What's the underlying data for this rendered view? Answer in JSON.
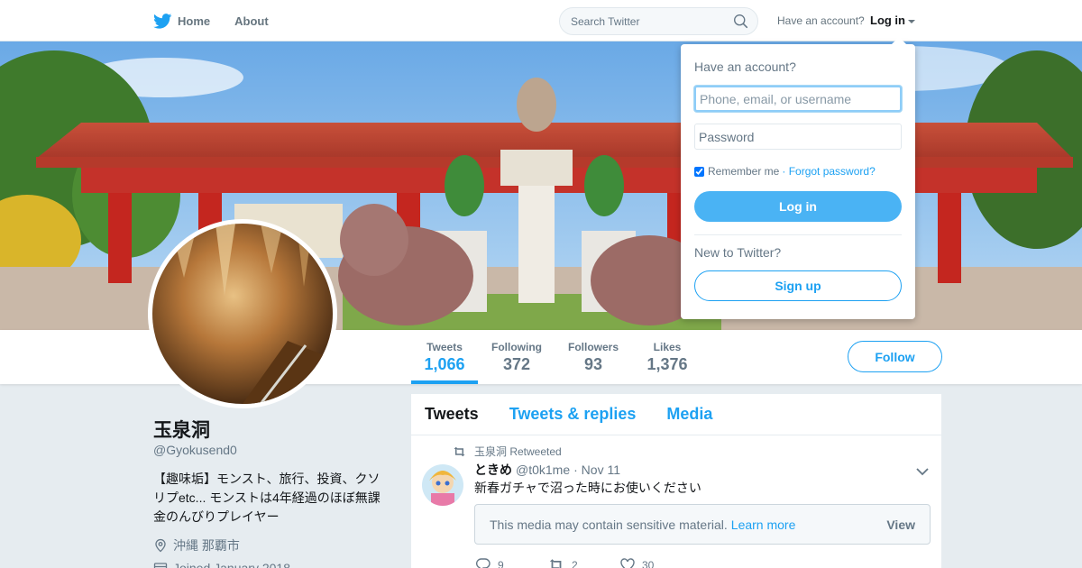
{
  "nav": {
    "home_label": "Home",
    "about_label": "About",
    "search_placeholder": "Search Twitter",
    "have_account": "Have an account?",
    "login_label": "Log in"
  },
  "profile": {
    "name": "玉泉洞",
    "handle": "@Gyokusend0",
    "bio": "【趣味垢】モンスト、旅行、投資、クソリプetc... モンストは4年経過のほぼ無課金のんびりプレイヤー",
    "location": "沖縄 那覇市",
    "joined": "Joined January 2018"
  },
  "stats": [
    {
      "label": "Tweets",
      "value": "1,066",
      "active": true
    },
    {
      "label": "Following",
      "value": "372",
      "active": false
    },
    {
      "label": "Followers",
      "value": "93",
      "active": false
    },
    {
      "label": "Likes",
      "value": "1,376",
      "active": false
    }
  ],
  "follow_label": "Follow",
  "timeline": {
    "tabs": [
      "Tweets",
      "Tweets & replies",
      "Media"
    ],
    "retweeted_by": "玉泉洞 Retweeted",
    "tweet": {
      "author": "ときめ",
      "handle": "@t0k1me",
      "date": "· Nov 11",
      "text": "新春ガチャで沼った時にお使いください",
      "sensitive_text": "This media may contain sensitive material.",
      "learn_more": "Learn more",
      "view_label": "View",
      "replies": "9",
      "retweets": "2",
      "likes": "30"
    }
  },
  "login_dropdown": {
    "title": "Have an account?",
    "username_placeholder": "Phone, email, or username",
    "password_placeholder": "Password",
    "remember_me": "Remember me",
    "forgot_password": "· Forgot password?",
    "login_button": "Log in",
    "new_to_twitter": "New to Twitter?",
    "signup_button": "Sign up",
    "remember_checked": true
  },
  "colors": {
    "twitter_blue": "#1da1f2",
    "login_button": "#4ab3f4",
    "background": "#e6ecf0"
  },
  "icons": [
    "twitter-bird-icon",
    "search-icon",
    "location-pin-icon",
    "calendar-icon",
    "retweet-icon",
    "chevron-down-icon",
    "reply-icon",
    "like-icon"
  ]
}
